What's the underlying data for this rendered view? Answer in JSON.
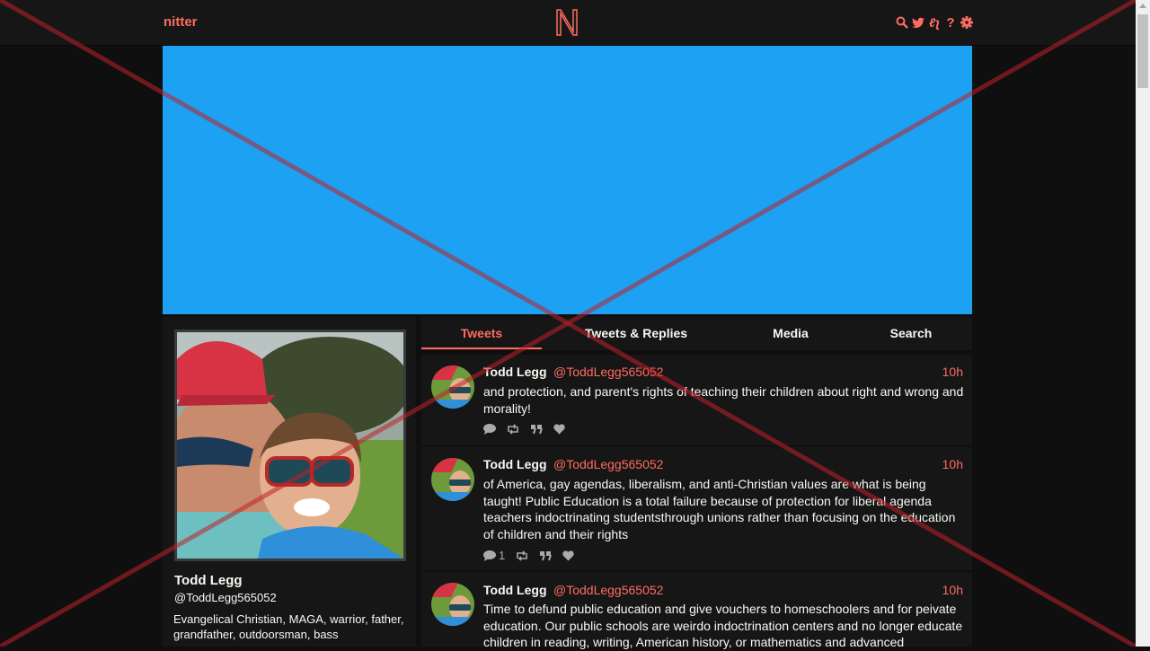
{
  "nav": {
    "brand": "nitter",
    "logo_letter": "N",
    "icons": [
      "search-icon",
      "twitter-icon",
      "rss-icon",
      "help-icon",
      "gear-icon"
    ],
    "rss_glyph": "ℓʅ",
    "help_glyph": "?"
  },
  "profile": {
    "fullname": "Todd Legg",
    "username": "@ToddLegg565052",
    "bio": "Evangelical Christian, MAGA, warrior, father, grandfather, outdoorsman, bass"
  },
  "tabs": [
    {
      "label": "Tweets",
      "active": true
    },
    {
      "label": "Tweets & Replies",
      "active": false
    },
    {
      "label": "Media",
      "active": false
    },
    {
      "label": "Search",
      "active": false
    }
  ],
  "tweets": [
    {
      "fullname": "Todd Legg",
      "username": "@ToddLegg565052",
      "date": "10h",
      "text": "and protection, and parent's rights of teaching their children about right and wrong and morality!",
      "replies": ""
    },
    {
      "fullname": "Todd Legg",
      "username": "@ToddLegg565052",
      "date": "10h",
      "text": "of America, gay agendas, liberalism, and anti-Christian values are what is being taught! Public Education is a total failure because of protection for liberal agenda teachers indoctrinating studentsthrough unions rather than focusing on the education of children and their rights",
      "replies": "1"
    },
    {
      "fullname": "Todd Legg",
      "username": "@ToddLegg565052",
      "date": "10h",
      "text": "Time to defund public education and give vouchers to homeschoolers and for peivate education. Our public schools are weirdo indoctrination centers and no longer educate children in reading, writing, American history, or mathematics and advanced",
      "replies": ""
    }
  ],
  "colors": {
    "accent": "#ff6c60",
    "banner": "#1da1f2",
    "background": "#0f0f0f",
    "panel": "#161616"
  }
}
